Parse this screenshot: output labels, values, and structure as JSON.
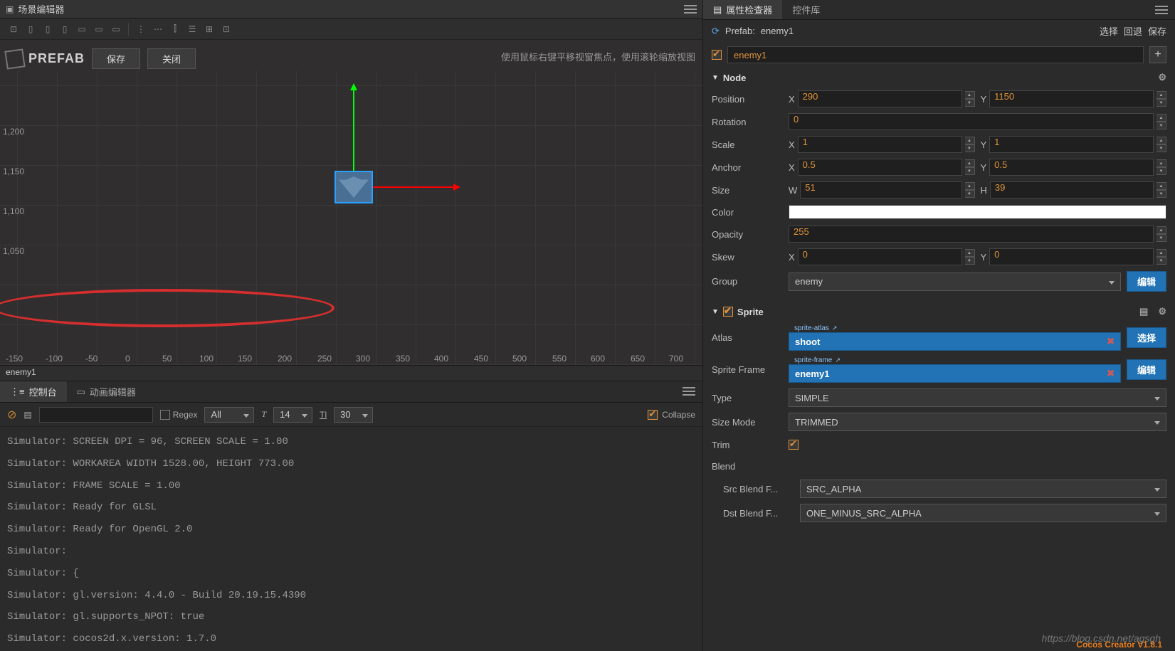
{
  "scene_editor": {
    "title": "场景编辑器",
    "prefab_label": "PREFAB",
    "save_btn": "保存",
    "close_btn": "关闭",
    "hint": "使用鼠标右键平移视窗焦点，使用滚轮缩放视图",
    "y_ticks": [
      "1,200",
      "1,150",
      "1,100",
      "1,050"
    ],
    "x_ticks": [
      "-150",
      "-100",
      "-50",
      "0",
      "50",
      "100",
      "150",
      "200",
      "250",
      "300",
      "350",
      "400",
      "450",
      "500",
      "550",
      "600",
      "650",
      "700"
    ],
    "status": "enemy1"
  },
  "console_panel": {
    "tab_console": "控制台",
    "tab_anim": "动画编辑器",
    "regex_label": "Regex",
    "filter": "All",
    "font_size": "14",
    "line_height": "30",
    "collapse_label": "Collapse",
    "logs": [
      "Simulator: SCREEN DPI = 96, SCREEN SCALE = 1.00",
      "Simulator: WORKAREA WIDTH 1528.00, HEIGHT 773.00",
      "Simulator: FRAME SCALE = 1.00",
      "Simulator: Ready for GLSL",
      "Simulator: Ready for OpenGL 2.0",
      "Simulator:",
      "Simulator: {",
      "Simulator: gl.version: 4.4.0 - Build 20.19.15.4390",
      "Simulator: gl.supports_NPOT: true",
      "Simulator: cocos2d.x.version: 1.7.0"
    ]
  },
  "inspector": {
    "tab_inspector": "属性检查器",
    "tab_widgets": "控件库",
    "prefab_label": "Prefab:",
    "prefab_name": "enemy1",
    "action_select": "选择",
    "action_revert": "回退",
    "action_save": "保存",
    "node_name": "enemy1",
    "node_section": "Node",
    "props": {
      "position": {
        "label": "Position",
        "x": "290",
        "y": "1150"
      },
      "rotation": {
        "label": "Rotation",
        "v": "0"
      },
      "scale": {
        "label": "Scale",
        "x": "1",
        "y": "1"
      },
      "anchor": {
        "label": "Anchor",
        "x": "0.5",
        "y": "0.5"
      },
      "size": {
        "label": "Size",
        "w": "51",
        "h": "39"
      },
      "color": {
        "label": "Color"
      },
      "opacity": {
        "label": "Opacity",
        "v": "255"
      },
      "skew": {
        "label": "Skew",
        "x": "0",
        "y": "0"
      },
      "group": {
        "label": "Group",
        "v": "enemy",
        "btn": "编辑"
      }
    },
    "sprite_section": "Sprite",
    "sprite": {
      "atlas": {
        "label": "Atlas",
        "tag": "sprite-atlas",
        "v": "shoot",
        "btn": "选择"
      },
      "frame": {
        "label": "Sprite Frame",
        "tag": "sprite-frame",
        "v": "enemy1",
        "btn": "编辑"
      },
      "type": {
        "label": "Type",
        "v": "SIMPLE"
      },
      "size_mode": {
        "label": "Size Mode",
        "v": "TRIMMED"
      },
      "trim": {
        "label": "Trim"
      },
      "blend": {
        "label": "Blend"
      },
      "src_blend": {
        "label": "Src Blend F...",
        "v": "SRC_ALPHA"
      },
      "dst_blend": {
        "label": "Dst Blend F...",
        "v": "ONE_MINUS_SRC_ALPHA"
      }
    }
  },
  "xy_labels": {
    "x": "X",
    "y": "Y",
    "w": "W",
    "h": "H"
  },
  "footer": {
    "watermark": "https://blog.csdn.net/agsgh",
    "version": "Cocos Creator V1.8.1"
  }
}
